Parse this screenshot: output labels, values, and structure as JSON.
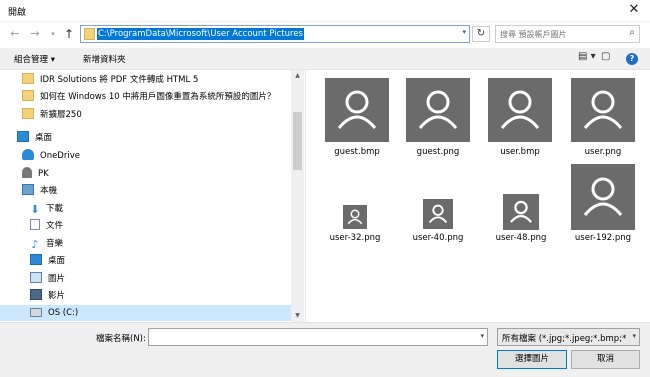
{
  "window": {
    "title": "開啟",
    "close_glyph": "✕"
  },
  "address": {
    "path": "C:\\ProgramData\\Microsoft\\User Account Pictures",
    "search_placeholder": "搜尋 預設帳戶圖片"
  },
  "nav": {
    "back": "←",
    "forward": "→",
    "dropdown": "▾",
    "up": "↑",
    "refresh": "↻",
    "search_glyph": "⌕"
  },
  "toolbar": {
    "organize_label": "組合管理 ▾",
    "new_folder_label": "新增資料夾",
    "view_glyph": "▤ ▾",
    "preview_glyph": "▢",
    "help_glyph": "?"
  },
  "sidebar": {
    "items": [
      {
        "label": "IDR Solutions 將 PDF 文件轉成 HTML 5",
        "icon": "folder-icon"
      },
      {
        "label": "如何在 Windows 10 中將用戶圖像重置為系統所預設的圖片？",
        "icon": "folder-icon"
      },
      {
        "label": "新擴層250",
        "icon": "folder-icon"
      },
      {
        "label": "桌面",
        "icon": "desktop-icon"
      },
      {
        "label": "OneDrive",
        "icon": "onedrive-icon"
      },
      {
        "label": "PK",
        "icon": "user-icon"
      },
      {
        "label": "本機",
        "icon": "this-pc-icon"
      },
      {
        "label": "下載",
        "icon": "downloads-icon"
      },
      {
        "label": "文件",
        "icon": "documents-icon"
      },
      {
        "label": "音樂",
        "icon": "music-icon"
      },
      {
        "label": "桌面",
        "icon": "desktop-icon"
      },
      {
        "label": "圖片",
        "icon": "pictures-icon"
      },
      {
        "label": "影片",
        "icon": "videos-icon"
      },
      {
        "label": "OS (C:)",
        "icon": "drive-icon"
      }
    ]
  },
  "files": [
    {
      "name": "guest.bmp"
    },
    {
      "name": "guest.png"
    },
    {
      "name": "user.bmp"
    },
    {
      "name": "user.png"
    },
    {
      "name": "user-32.png"
    },
    {
      "name": "user-40.png"
    },
    {
      "name": "user-48.png"
    },
    {
      "name": "user-192.png"
    }
  ],
  "footer": {
    "filename_label": "檔案名稱(N):",
    "filename_value": "",
    "filter_label": "所有檔案 (*.jpg;*.jpeg;*.bmp;*",
    "open_label": "選擇圖片",
    "cancel_label": "取消"
  },
  "colors": {
    "accent": "#0078d7",
    "thumb_bg": "#6b6b6b",
    "selected_bg": "#cce8ff"
  }
}
